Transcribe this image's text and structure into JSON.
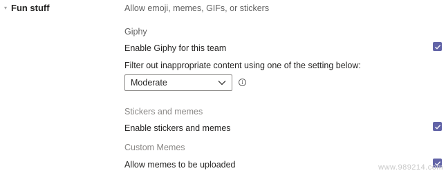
{
  "section": {
    "title": "Fun stuff",
    "caret_icon": "chevron-down-icon",
    "description": "Allow emoji, memes, GIFs, or stickers"
  },
  "giphy": {
    "heading": "Giphy",
    "enable_label": "Enable Giphy for this team",
    "enable_checked": true,
    "filter_label": "Filter out inappropriate content using one of the setting below:",
    "filter_selected": "Moderate",
    "info_icon": "info-icon"
  },
  "stickers": {
    "heading": "Stickers and memes",
    "enable_label": "Enable stickers and memes",
    "enable_checked": true
  },
  "custom_memes": {
    "heading": "Custom Memes",
    "allow_label": "Allow memes to be uploaded",
    "allow_checked": true
  },
  "watermark": "www.989214.com",
  "colors": {
    "accent": "#6264a7",
    "text": "#252423",
    "muted": "#616161"
  }
}
